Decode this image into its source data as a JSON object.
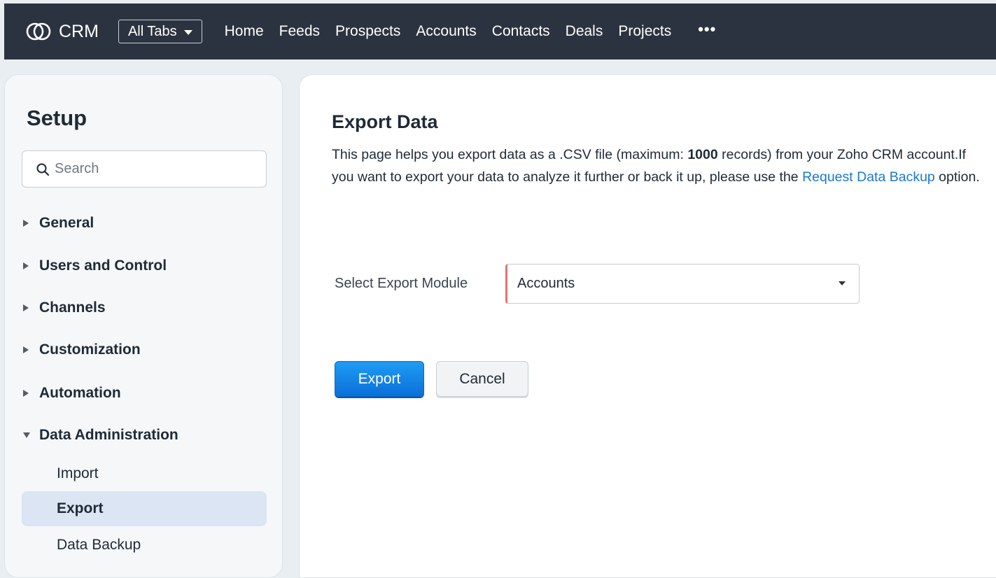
{
  "topbar": {
    "brand": "CRM",
    "all_tabs": "All Tabs",
    "nav": [
      "Home",
      "Feeds",
      "Prospects",
      "Accounts",
      "Contacts",
      "Deals",
      "Projects"
    ],
    "more": "•••"
  },
  "sidebar": {
    "title": "Setup",
    "search_placeholder": "Search",
    "groups": [
      "General",
      "Users and Control",
      "Channels",
      "Customization",
      "Automation",
      "Data Administration"
    ],
    "sub_items": [
      "Import",
      "Export",
      "Data Backup"
    ]
  },
  "main": {
    "title": "Export Data",
    "desc_part1": "This page helps you export data as a .CSV file (maximum: ",
    "desc_bold": "1000",
    "desc_part2": " records) from your Zoho CRM account.If you want to export your data to analyze it further or back it up, please use the ",
    "desc_link": "Request Data Backup",
    "desc_part3": " option.",
    "module_label": "Select Export Module",
    "module_value": "Accounts",
    "export_label": "Export",
    "cancel_label": "Cancel"
  },
  "colors": {
    "topbar_bg": "#2c3340",
    "link": "#1a78d2",
    "primary": "#0a6fd8",
    "active_item_bg": "#dbe5f3",
    "required_marker": "#e57373"
  }
}
